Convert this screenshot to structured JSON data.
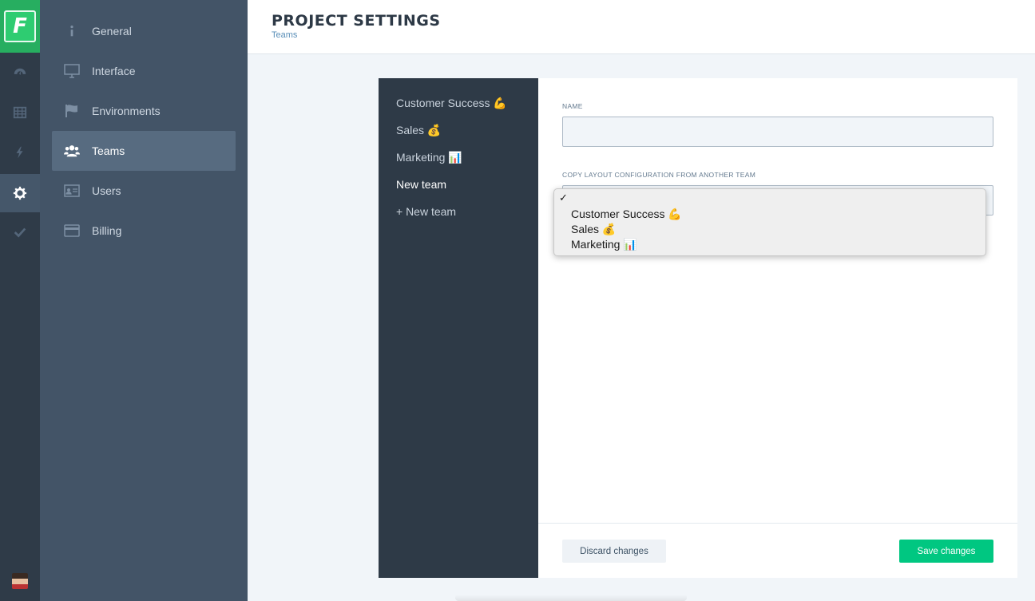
{
  "logo": {
    "letter": "F"
  },
  "rail": {
    "icons": [
      "dashboard-icon",
      "grid-icon",
      "bolt-icon",
      "gear-icon",
      "check-icon"
    ],
    "active": "gear-icon"
  },
  "sidebar": {
    "items": [
      {
        "label": "General",
        "icon": "info-icon"
      },
      {
        "label": "Interface",
        "icon": "monitor-icon"
      },
      {
        "label": "Environments",
        "icon": "flag-icon"
      },
      {
        "label": "Teams",
        "icon": "users-icon",
        "active": true
      },
      {
        "label": "Users",
        "icon": "id-card-icon"
      },
      {
        "label": "Billing",
        "icon": "credit-card-icon"
      }
    ]
  },
  "header": {
    "title": "PROJECT SETTINGS",
    "subtitle": "Teams"
  },
  "teams": {
    "items": [
      {
        "label": "Customer Success 💪"
      },
      {
        "label": "Sales 💰"
      },
      {
        "label": "Marketing 📊"
      },
      {
        "label": "New team",
        "current": true
      }
    ],
    "add_label": "+ New team"
  },
  "form": {
    "name_label": "Name",
    "name_value": "",
    "copy_label": "Copy layout configuration from another team"
  },
  "dropdown": {
    "check": "✓",
    "options": [
      "Customer Success 💪",
      "Sales 💰",
      "Marketing 📊"
    ]
  },
  "footer": {
    "discard_label": "Discard changes",
    "save_label": "Save changes"
  },
  "colors": {
    "accent": "#00c781",
    "rail": "#2f3b48",
    "sidebar": "#435467",
    "teams_bg": "#2e3a47"
  }
}
